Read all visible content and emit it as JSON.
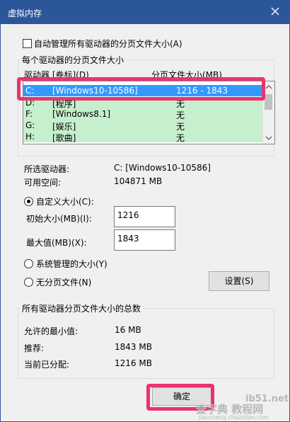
{
  "window": {
    "title": "虚拟内存"
  },
  "auto_manage": {
    "label": "自动管理所有驱动器的分页文件大小(A)"
  },
  "drives_group": {
    "title": "每个驱动器的分页文件大小",
    "col_drive": "驱动器 [卷标](D)",
    "col_size": "分页文件大小(MB)",
    "rows": [
      {
        "letter": "C:",
        "label": "[Windows10-10586]",
        "size": "1216 - 1843"
      },
      {
        "letter": "D:",
        "label": "[程序]",
        "size": "无"
      },
      {
        "letter": "F:",
        "label": "[Windows8.1]",
        "size": "无"
      },
      {
        "letter": "G:",
        "label": "[娱乐]",
        "size": "无"
      },
      {
        "letter": "H:",
        "label": "[歌曲]",
        "size": "无"
      }
    ]
  },
  "selected": {
    "drive_label": "所选驱动器:",
    "drive_value": "C:  [Windows10-10586]",
    "space_label": "可用空间:",
    "space_value": "104871 MB"
  },
  "custom": {
    "radio_label": "自定义大小(C):",
    "initial_label": "初始大小(MB)(I):",
    "initial_value": "1216",
    "max_label": "最大值(MB)(X):",
    "max_value": "1843"
  },
  "system_managed": {
    "label": "系统管理的大小(Y)"
  },
  "no_paging": {
    "label": "无分页文件(N)"
  },
  "set_button": {
    "label": "设置(S)"
  },
  "totals": {
    "title": "所有驱动器分页文件大小的总数",
    "min_label": "允许的最小值:",
    "min_value": "16 MB",
    "rec_label": "推荐:",
    "rec_value": "1843 MB",
    "cur_label": "当前已分配:",
    "cur_value": "1216 MB"
  },
  "ok_button": {
    "label": "确定"
  },
  "watermarks": {
    "site": "ib51.net",
    "cn": "查字典 教程网",
    "url": "jiaocheng.chazidian.com"
  },
  "colors": {
    "titlebar": "#2b579a",
    "selection": "#3399ff",
    "highlight": "#e8346e",
    "row_bg": "#c6efce"
  }
}
